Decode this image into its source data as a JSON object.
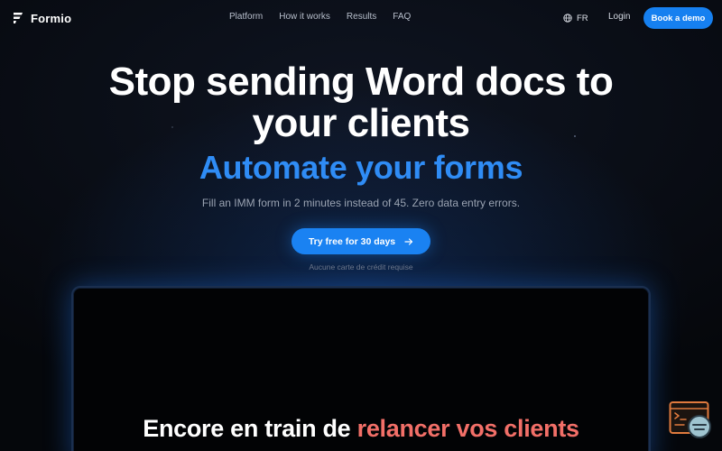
{
  "nav": {
    "brand": "Formio",
    "links": [
      "Platform",
      "How it works",
      "Results",
      "FAQ"
    ],
    "language": "FR",
    "login": "Login",
    "demo_label": "Book a demo"
  },
  "hero": {
    "title_line1": "Stop sending Word docs to",
    "title_line2": "your clients",
    "subtitle": "Automate your forms",
    "description": "Fill an IMM form in 2 minutes instead of 45. Zero data entry errors.",
    "cta_label": "Try free for 30 days",
    "cta_note": "Aucune carte de crédit requise"
  },
  "video": {
    "caption_part1": "Encore en train de ",
    "caption_part2": "relancer vos clients"
  },
  "colors": {
    "accent": "#1a82f2",
    "subtitle": "#2f8cf5",
    "caption_accent": "#f26f68",
    "background": "#05070b"
  },
  "icons": {
    "brand": "formio-logo-icon",
    "language": "globe-icon",
    "cta": "arrow-right-icon",
    "widget": "chat-widget-icon"
  }
}
